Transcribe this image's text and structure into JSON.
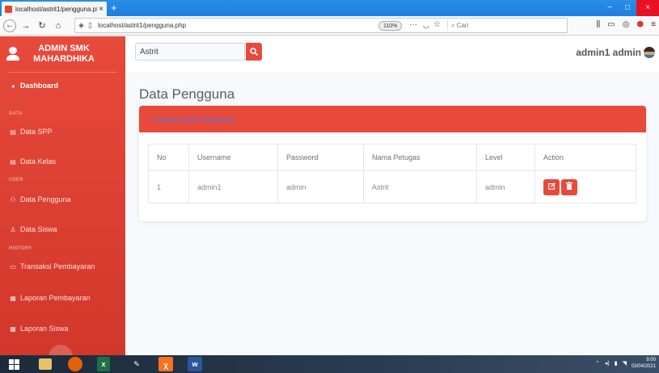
{
  "browser": {
    "tab_title": "localhost/astrit1/pengguna.ph",
    "tab_close": "×",
    "new_tab": "+",
    "url": "localhost/astrit1/pengguna.php",
    "zoom": "110%",
    "search_placeholder": "Cari",
    "window_min": "−",
    "window_max": "□",
    "window_close": "×"
  },
  "sidebar": {
    "brand": "ADMIN SMK MAHARDHIKA",
    "dashboard": "Dashboard",
    "heading_data": "DATA",
    "heading_user": "USER",
    "heading_history": "HISTORY",
    "items": [
      {
        "label": "Data SPP",
        "icon": "table-icon"
      },
      {
        "label": "Data Kelas",
        "icon": "table-icon"
      },
      {
        "label": "Data Pengguna",
        "icon": "users-icon"
      },
      {
        "label": "Data Siswa",
        "icon": "user-icon"
      },
      {
        "label": "Transaksi Pembayaran",
        "icon": "money-icon"
      },
      {
        "label": "Laporan Pembayaran",
        "icon": "report-icon"
      },
      {
        "label": "Laporan Siswa",
        "icon": "report-icon"
      }
    ]
  },
  "topbar": {
    "search_value": "Astrit",
    "user_name": "admin1 admin"
  },
  "page": {
    "title": "Data Pengguna",
    "add_button": "Tambah Data Pengguna"
  },
  "table": {
    "headers": [
      "No",
      "Username",
      "Password",
      "Nama Petugas",
      "Level",
      "Action"
    ],
    "rows": [
      {
        "no": "1",
        "username": "admin1",
        "password": "admin",
        "nama": "Astrit",
        "level": "admin"
      }
    ]
  },
  "taskbar": {
    "time": "9:00",
    "date": "03/04/2021"
  },
  "colors": {
    "accent": "#e74a3b",
    "browser_blue": "#1c7fdc"
  }
}
